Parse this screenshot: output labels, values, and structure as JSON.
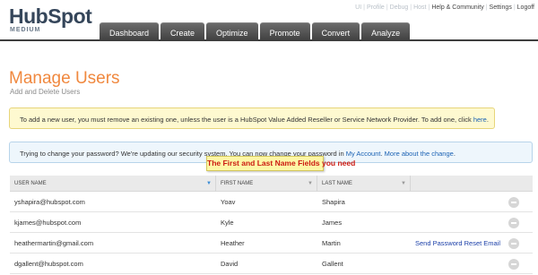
{
  "logo": {
    "name": "HubSpot",
    "edition": "MEDIUM"
  },
  "toplinks": {
    "faint": [
      "UI",
      "Profile",
      "Debug",
      "Host"
    ],
    "main": [
      "Help & Community",
      "Settings",
      "Logoff"
    ]
  },
  "nav": {
    "tabs": [
      "Dashboard",
      "Create",
      "Optimize",
      "Promote",
      "Convert",
      "Analyze"
    ]
  },
  "page": {
    "title": "Manage Users",
    "subtitle": "Add and Delete Users"
  },
  "notice_limit": {
    "text": "To add a new user, you must remove an existing one, unless the user is a HubSpot Value Added Reseller or Service Network Provider. To add one, click ",
    "link": "here",
    "end": "."
  },
  "notice_password": {
    "text": "Trying to change your password? We're updating our security system. You can now change your password in ",
    "link1": "My Account",
    "mid": ". ",
    "link2": "More about the change",
    "end": "."
  },
  "callout": "The First and Last Name Fields you need",
  "table": {
    "headers": {
      "user": "USER NAME",
      "first": "FIRST NAME",
      "last": "LAST NAME"
    },
    "rows": [
      {
        "user": "yshapira@hubspot.com",
        "first": "Yoav",
        "last": "Shapira",
        "action": ""
      },
      {
        "user": "kjames@hubspot.com",
        "first": "Kyle",
        "last": "James",
        "action": ""
      },
      {
        "user": "heathermartin@gmail.com",
        "first": "Heather",
        "last": "Martin",
        "action": "Send Password Reset Email"
      },
      {
        "user": "dgallent@hubspot.com",
        "first": "David",
        "last": "Gallent",
        "action": ""
      }
    ]
  },
  "colors": {
    "accent": "#f0883e",
    "nav": "#3f3f3f",
    "callout_text": "#cc1b12",
    "link": "#1b62b4"
  }
}
